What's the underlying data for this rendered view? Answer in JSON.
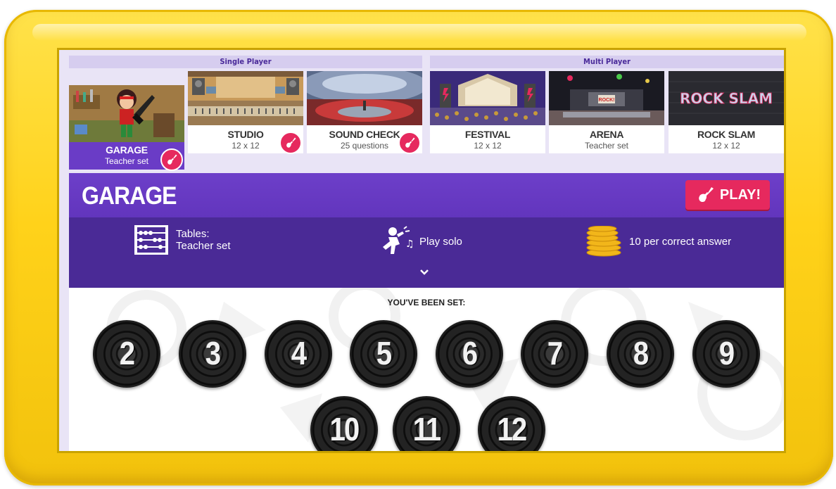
{
  "sections": {
    "single": "Single Player",
    "multi": "Multi Player"
  },
  "modes": [
    {
      "name": "GARAGE",
      "sub": "Teacher set"
    },
    {
      "name": "STUDIO",
      "sub": "12 x 12"
    },
    {
      "name": "SOUND CHECK",
      "sub": "25 questions"
    },
    {
      "name": "FESTIVAL",
      "sub": "12 x 12"
    },
    {
      "name": "ARENA",
      "sub": "Teacher set"
    },
    {
      "name": "ROCK SLAM",
      "sub": "12 x 12"
    }
  ],
  "thumb_text": {
    "arena_sign": "ROCK!",
    "rock_slam_logo": "ROCK SLAM"
  },
  "header": {
    "title": "GARAGE",
    "play_label": "PLAY!"
  },
  "info": {
    "tables_label": "Tables:",
    "tables_value": "Teacher set",
    "play_mode": "Play solo",
    "coins": "10 per correct answer"
  },
  "set": {
    "title": "YOU'VE BEEN SET:",
    "numbers": [
      "2",
      "3",
      "4",
      "5",
      "6",
      "7",
      "8",
      "9",
      "10",
      "11",
      "12"
    ]
  },
  "icons": [
    "guitar-icon",
    "abacus-icon",
    "singer-icon",
    "coins-icon",
    "chevron-down-icon"
  ],
  "colors": {
    "accent": "#6a3cc6",
    "dark_purple": "#4a2a96",
    "pink": "#e6295e",
    "frame": "#ffd21a"
  }
}
